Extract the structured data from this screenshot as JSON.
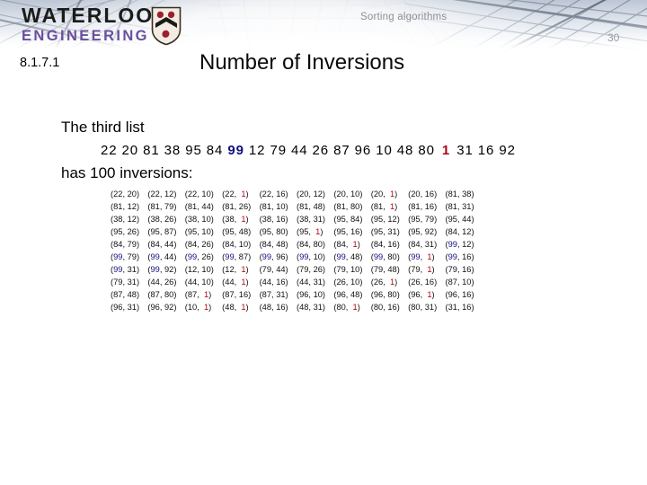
{
  "header": {
    "wordmark_line1": "WATERLOO",
    "wordmark_line2": "ENGINEERING",
    "kicker": "Sorting algorithms",
    "page_number": "30",
    "accent_purple": "#6b4f9e",
    "crest_red": "#9c1f2e"
  },
  "slide": {
    "id": "8.1.7.1",
    "title": "Number of Inversions"
  },
  "body": {
    "lead_1": "The third list",
    "lead_2": "has 100 inversions:",
    "highlight_blue": "#12107e",
    "highlight_red": "#b00018",
    "list_prefix": "22 20 81 38 95 84",
    "list_blue": "99",
    "list_middle": "12 79 44 26 87 96 10 48 80",
    "list_red": "1",
    "list_suffix": "31  16  92"
  },
  "inversions": {
    "count": 100,
    "rows": [
      [
        [
          "22",
          "20"
        ],
        [
          "22",
          "12"
        ],
        [
          "22",
          "10"
        ],
        [
          "22",
          "1"
        ],
        [
          "22",
          "16"
        ],
        [
          "20",
          "12"
        ],
        [
          "20",
          "10"
        ],
        [
          "20",
          "1"
        ],
        [
          "20",
          "16"
        ],
        [
          "81",
          "38"
        ]
      ],
      [
        [
          "81",
          "12"
        ],
        [
          "81",
          "79"
        ],
        [
          "81",
          "44"
        ],
        [
          "81",
          "26"
        ],
        [
          "81",
          "10"
        ],
        [
          "81",
          "48"
        ],
        [
          "81",
          "80"
        ],
        [
          "81",
          "1"
        ],
        [
          "81",
          "16"
        ],
        [
          "81",
          "31"
        ]
      ],
      [
        [
          "38",
          "12"
        ],
        [
          "38",
          "26"
        ],
        [
          "38",
          "10"
        ],
        [
          "38",
          "1"
        ],
        [
          "38",
          "16"
        ],
        [
          "38",
          "31"
        ],
        [
          "95",
          "84"
        ],
        [
          "95",
          "12"
        ],
        [
          "95",
          "79"
        ],
        [
          "95",
          "44"
        ]
      ],
      [
        [
          "95",
          "26"
        ],
        [
          "95",
          "87"
        ],
        [
          "95",
          "10"
        ],
        [
          "95",
          "48"
        ],
        [
          "95",
          "80"
        ],
        [
          "95",
          "1"
        ],
        [
          "95",
          "16"
        ],
        [
          "95",
          "31"
        ],
        [
          "95",
          "92"
        ],
        [
          "84",
          "12"
        ]
      ],
      [
        [
          "84",
          "79"
        ],
        [
          "84",
          "44"
        ],
        [
          "84",
          "26"
        ],
        [
          "84",
          "10"
        ],
        [
          "84",
          "48"
        ],
        [
          "84",
          "80"
        ],
        [
          "84",
          "1"
        ],
        [
          "84",
          "16"
        ],
        [
          "84",
          "31"
        ],
        [
          "99",
          "12"
        ]
      ],
      [
        [
          "99",
          "79"
        ],
        [
          "99",
          "44"
        ],
        [
          "99",
          "26"
        ],
        [
          "99",
          "87"
        ],
        [
          "99",
          "96"
        ],
        [
          "99",
          "10"
        ],
        [
          "99",
          "48"
        ],
        [
          "99",
          "80"
        ],
        [
          "99",
          "1"
        ],
        [
          "99",
          "16"
        ]
      ],
      [
        [
          "99",
          "31"
        ],
        [
          "99",
          "92"
        ],
        [
          "12",
          "10"
        ],
        [
          "12",
          "1"
        ],
        [
          "79",
          "44"
        ],
        [
          "79",
          "26"
        ],
        [
          "79",
          "10"
        ],
        [
          "79",
          "48"
        ],
        [
          "79",
          "1"
        ],
        [
          "79",
          "16"
        ]
      ],
      [
        [
          "79",
          "31"
        ],
        [
          "44",
          "26"
        ],
        [
          "44",
          "10"
        ],
        [
          "44",
          "1"
        ],
        [
          "44",
          "16"
        ],
        [
          "44",
          "31"
        ],
        [
          "26",
          "10"
        ],
        [
          "26",
          "1"
        ],
        [
          "26",
          "16"
        ],
        [
          "87",
          "10"
        ]
      ],
      [
        [
          "87",
          "48"
        ],
        [
          "87",
          "80"
        ],
        [
          "87",
          "1"
        ],
        [
          "87",
          "16"
        ],
        [
          "87",
          "31"
        ],
        [
          "96",
          "10"
        ],
        [
          "96",
          "48"
        ],
        [
          "96",
          "80"
        ],
        [
          "96",
          "1"
        ],
        [
          "96",
          "16"
        ]
      ],
      [
        [
          "96",
          "31"
        ],
        [
          "96",
          "92"
        ],
        [
          "10",
          "1"
        ],
        [
          "48",
          "1"
        ],
        [
          "48",
          "16"
        ],
        [
          "48",
          "31"
        ],
        [
          "80",
          "1"
        ],
        [
          "80",
          "16"
        ],
        [
          "80",
          "31"
        ],
        [
          "31",
          "16"
        ]
      ]
    ]
  }
}
